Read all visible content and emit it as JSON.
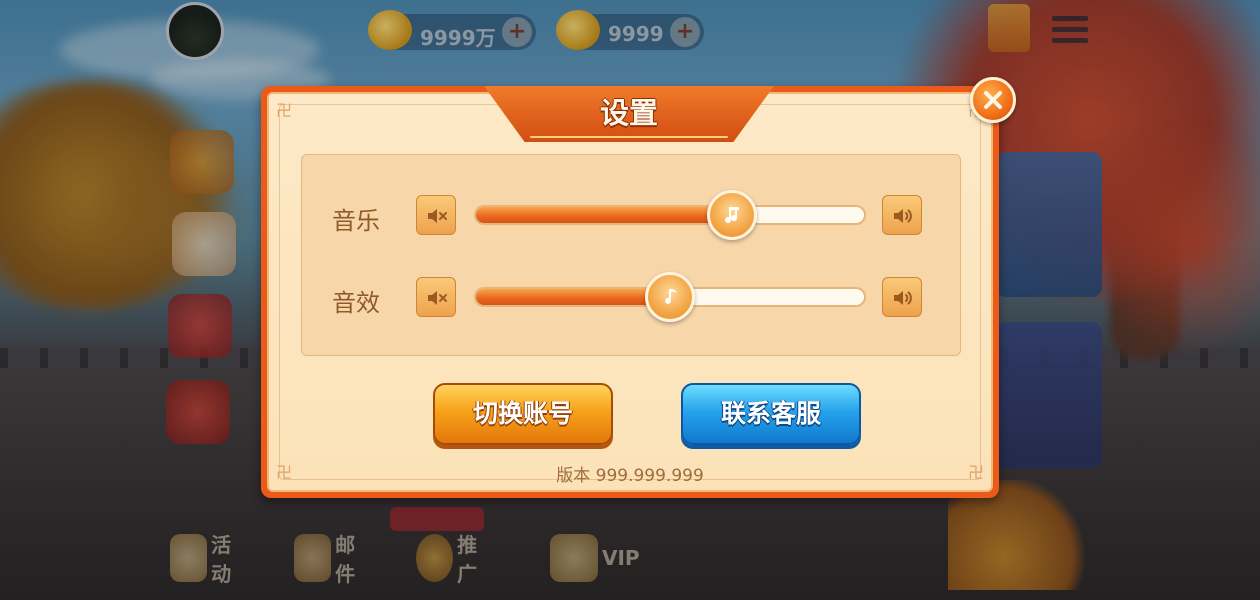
{
  "background": {
    "currencies": [
      {
        "value": "9999万",
        "icon": "gold-ingot-icon"
      },
      {
        "value": "9999",
        "icon": "gold-coin-icon"
      }
    ],
    "bottom_nav": [
      {
        "label": "活动",
        "icon": "gift-icon"
      },
      {
        "label": "邮件",
        "icon": "mail-icon"
      },
      {
        "label": "推广",
        "icon": "promote-icon"
      },
      {
        "label": "VIP",
        "icon": "vip-icon"
      }
    ]
  },
  "dialog": {
    "title": "设置",
    "close_icon": "close-icon",
    "music": {
      "label": "音乐",
      "level": 0.66
    },
    "sfx": {
      "label": "音效",
      "level": 0.5
    },
    "buttons": {
      "switch_account": "切换账号",
      "contact_service": "联系客服"
    },
    "version": "版本 999.999.999"
  },
  "colors": {
    "dialog_border": "#ea5a1a",
    "dialog_bg": "#fde9c7",
    "slider_fill": "#e8661c",
    "button_orange": "#f7a21a",
    "button_blue": "#26a3ec"
  }
}
